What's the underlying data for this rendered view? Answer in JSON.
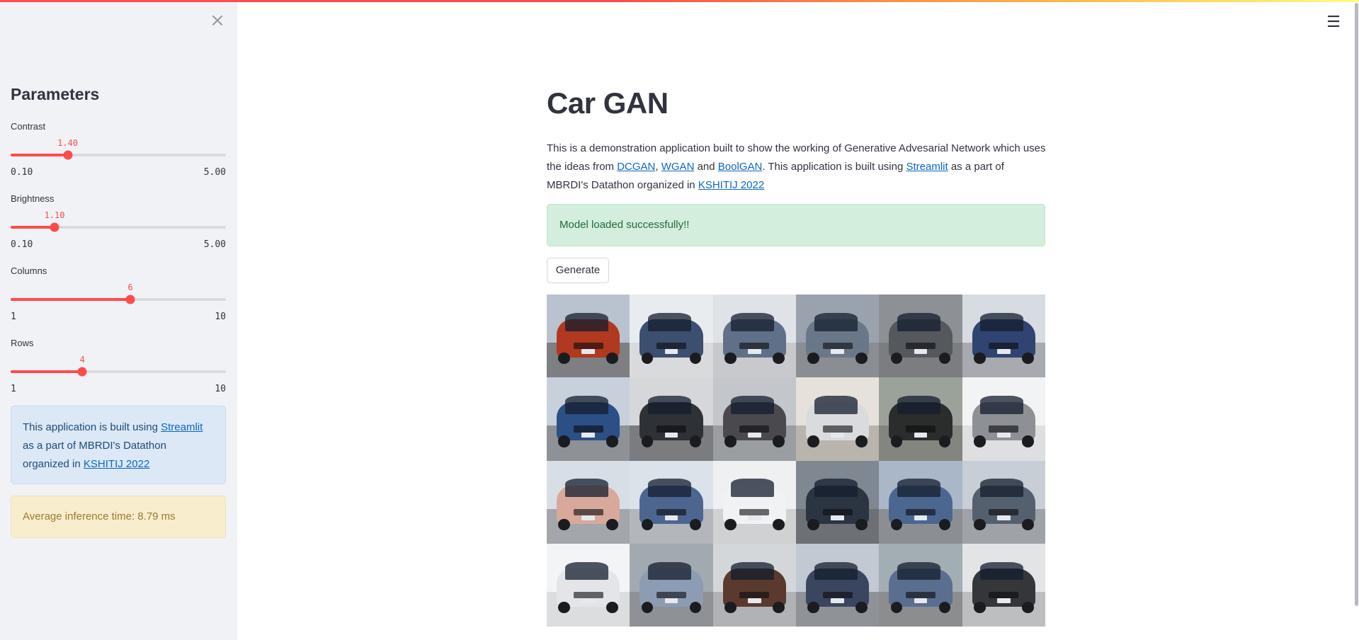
{
  "sidebar": {
    "title": "Parameters",
    "sliders": [
      {
        "label": "Contrast",
        "value": "1.40",
        "min": "0.10",
        "max": "5.00",
        "fraction": 0.265
      },
      {
        "label": "Brightness",
        "value": "1.10",
        "min": "0.10",
        "max": "5.00",
        "fraction": 0.204
      },
      {
        "label": "Columns",
        "value": "6",
        "min": "1",
        "max": "10",
        "fraction": 0.556
      },
      {
        "label": "Rows",
        "value": "4",
        "min": "1",
        "max": "10",
        "fraction": 0.333
      }
    ],
    "info": {
      "prefix": "This application is built using ",
      "link1": "Streamlit",
      "middle": " as a part of MBRDI's Datathon organized in ",
      "link2": "KSHITIJ 2022"
    },
    "inference": "Average inference time: 8.79 ms"
  },
  "main": {
    "title": "Car GAN",
    "description": {
      "p1": "This is a demonstration application built to show the working of Generative Advesarial Network which uses the ideas from ",
      "link_dcgan": "DCGAN",
      "sep1": ", ",
      "link_wgan": "WGAN",
      "sep2": " and ",
      "link_boolgan": "BoolGAN",
      "p2": ". This application is built using ",
      "link_streamlit": "Streamlit",
      "p3": " as a part of MBRDI's Datathon organized in ",
      "link_kshitij": "KSHITIJ 2022"
    },
    "success": "Model loaded successfully!!",
    "generate_label": "Generate",
    "grid": {
      "columns": 6,
      "rows": 4,
      "images": [
        {
          "bg": "#b9c3cf",
          "ground": "#7d7f82",
          "car": "#b0391f"
        },
        {
          "bg": "#e9ecef",
          "ground": "#d9dadc",
          "car": "#3d4f6e"
        },
        {
          "bg": "#dfe3e7",
          "ground": "#c7c9cc",
          "car": "#5f7088"
        },
        {
          "bg": "#9aa3ad",
          "ground": "#8a8d91",
          "car": "#6a7788"
        },
        {
          "bg": "#8d9196",
          "ground": "#7b7d80",
          "car": "#55585d"
        },
        {
          "bg": "#d7dce2",
          "ground": "#a7aaae",
          "car": "#2f4470"
        },
        {
          "bg": "#c8d0dc",
          "ground": "#8e9195",
          "car": "#2c4f86"
        },
        {
          "bg": "#d5d7da",
          "ground": "#7a7c7f",
          "car": "#2e3136"
        },
        {
          "bg": "#c3c6cb",
          "ground": "#9a9da1",
          "car": "#4a4a4e"
        },
        {
          "bg": "#e6e2db",
          "ground": "#b9b4ac",
          "car": "#d9dbdd"
        },
        {
          "bg": "#9ba29a",
          "ground": "#83857f",
          "car": "#2b2d2c"
        },
        {
          "bg": "#f2f3f4",
          "ground": "#dedfe1",
          "car": "#8d9094"
        },
        {
          "bg": "#d8dee6",
          "ground": "#a3a6aa",
          "car": "#d8a99a"
        },
        {
          "bg": "#dbe2ea",
          "ground": "#b3b6ba",
          "car": "#4d6690"
        },
        {
          "bg": "#eef0f2",
          "ground": "#cfd1d3",
          "car": "#f1f2f3"
        },
        {
          "bg": "#7f8790",
          "ground": "#6d7074",
          "car": "#2b3542"
        },
        {
          "bg": "#a9b7c9",
          "ground": "#8b8f94",
          "car": "#4b6790"
        },
        {
          "bg": "#c7ced6",
          "ground": "#9fa3a8",
          "car": "#54606d"
        },
        {
          "bg": "#f3f4f5",
          "ground": "#dcdddf",
          "car": "#e3e5e8"
        },
        {
          "bg": "#a2a9b0",
          "ground": "#8e9195",
          "car": "#8c9cb3"
        },
        {
          "bg": "#d4d7da",
          "ground": "#b0b2b5",
          "car": "#5a3a2e"
        },
        {
          "bg": "#c2c9d2",
          "ground": "#8f9297",
          "car": "#3a4660"
        },
        {
          "bg": "#a3adb4",
          "ground": "#8b8d8f",
          "car": "#5a6f8f"
        },
        {
          "bg": "#e3e4e6",
          "ground": "#bdbec0",
          "car": "#35363a"
        }
      ]
    }
  },
  "colors": {
    "accent": "#ff4b4b",
    "info_bg": "#dce8f5",
    "success_bg": "#d4eedd",
    "warning_bg": "#f8edcc"
  },
  "icons": {
    "close": "close-icon",
    "menu": "hamburger-menu-icon"
  }
}
